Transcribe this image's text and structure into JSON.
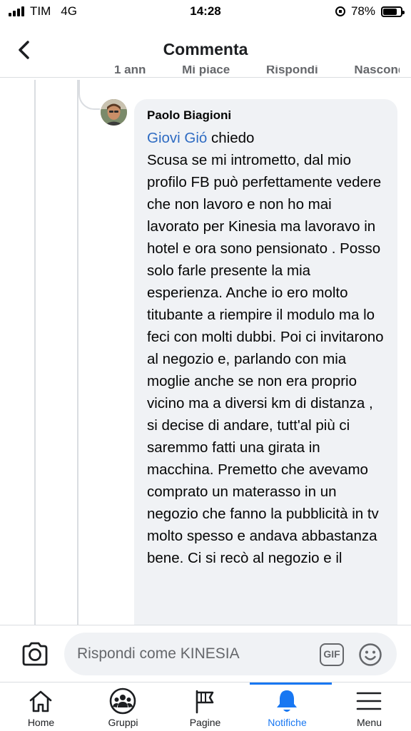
{
  "status_bar": {
    "carrier": "TIM",
    "network": "4G",
    "time": "14:28",
    "battery": "78%",
    "battery_level": 0.78
  },
  "header": {
    "title": "Commenta"
  },
  "previous_comment_actions": [
    "1 ann",
    "Mi piace",
    "Rispondi",
    "Nascondi"
  ],
  "comment": {
    "author": "Paolo Biagioni",
    "mention": "Giovi Gió",
    "text_after_mention": " chiedo",
    "body": "Scusa se mi intrometto, dal mio profilo FB può perfettamente vedere che non lavoro e non ho mai lavorato per Kinesia ma lavoravo in hotel e ora sono pensionato . Posso solo farle presente la mia esperienza. Anche io ero molto titubante a riempire il modulo ma lo feci con molti dubbi. Poi ci invitarono al negozio e, parlando con mia moglie anche se non era proprio vicino ma a diversi km di distanza , si decise di andare, tutt'al più ci saremmo fatti una girata in macchina. Premetto che avevamo comprato un materasso in un negozio che fanno la pubblicità in tv molto spesso e andava abbastanza bene. Ci si recò al negozio e il"
  },
  "reply_bar": {
    "placeholder": "Rispondi come KINESIA",
    "gif_label": "GIF"
  },
  "tabs": [
    {
      "label": "Home",
      "icon": "home-icon"
    },
    {
      "label": "Gruppi",
      "icon": "groups-icon"
    },
    {
      "label": "Pagine",
      "icon": "flag-icon"
    },
    {
      "label": "Notifiche",
      "icon": "bell-icon",
      "active": true
    },
    {
      "label": "Menu",
      "icon": "menu-icon"
    }
  ],
  "colors": {
    "accent": "#1877f2",
    "mention": "#2e6bc2",
    "bubble": "#f0f2f5",
    "muted": "#65676b"
  }
}
